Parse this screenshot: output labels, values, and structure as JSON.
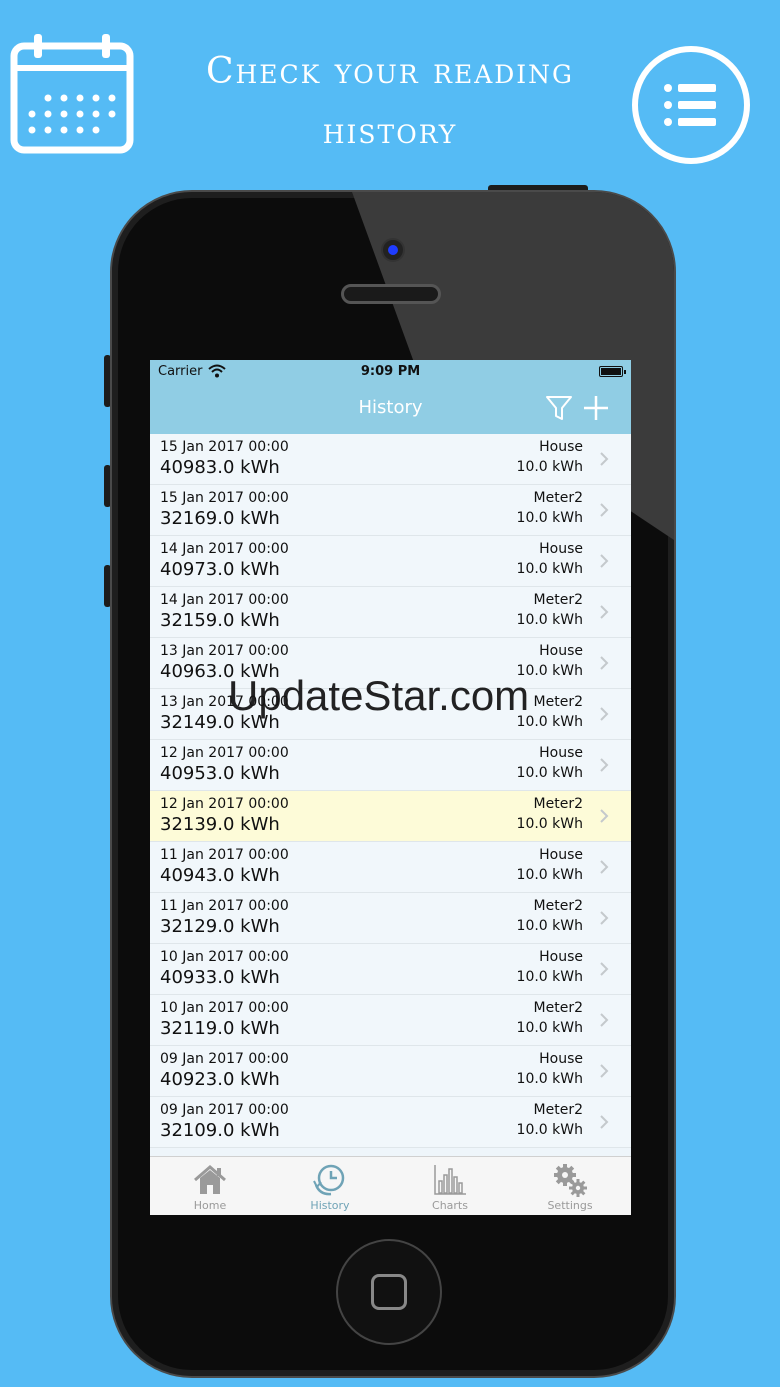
{
  "headline": {
    "line1": "Check your reading",
    "line2": "history"
  },
  "status": {
    "carrier": "Carrier",
    "time": "9:09 PM"
  },
  "nav": {
    "title": "History"
  },
  "rows": [
    {
      "date": "15 Jan 2017 00:00",
      "value": "40983.0 kWh",
      "meter": "House",
      "delta": "10.0 kWh"
    },
    {
      "date": "15 Jan 2017 00:00",
      "value": "32169.0 kWh",
      "meter": "Meter2",
      "delta": "10.0 kWh"
    },
    {
      "date": "14 Jan 2017 00:00",
      "value": "40973.0 kWh",
      "meter": "House",
      "delta": "10.0 kWh"
    },
    {
      "date": "14 Jan 2017 00:00",
      "value": "32159.0 kWh",
      "meter": "Meter2",
      "delta": "10.0 kWh"
    },
    {
      "date": "13 Jan 2017 00:00",
      "value": "40963.0 kWh",
      "meter": "House",
      "delta": "10.0 kWh"
    },
    {
      "date": "13 Jan 2017 00:00",
      "value": "32149.0 kWh",
      "meter": "Meter2",
      "delta": "10.0 kWh"
    },
    {
      "date": "12 Jan 2017 00:00",
      "value": "40953.0 kWh",
      "meter": "House",
      "delta": "10.0 kWh"
    },
    {
      "date": "12 Jan 2017 00:00",
      "value": "32139.0 kWh",
      "meter": "Meter2",
      "delta": "10.0 kWh",
      "highlight": true
    },
    {
      "date": "11 Jan 2017 00:00",
      "value": "40943.0 kWh",
      "meter": "House",
      "delta": "10.0 kWh"
    },
    {
      "date": "11 Jan 2017 00:00",
      "value": "32129.0 kWh",
      "meter": "Meter2",
      "delta": "10.0 kWh"
    },
    {
      "date": "10 Jan 2017 00:00",
      "value": "40933.0 kWh",
      "meter": "House",
      "delta": "10.0 kWh"
    },
    {
      "date": "10 Jan 2017 00:00",
      "value": "32119.0 kWh",
      "meter": "Meter2",
      "delta": "10.0 kWh"
    },
    {
      "date": "09 Jan 2017 00:00",
      "value": "40923.0 kWh",
      "meter": "House",
      "delta": "10.0 kWh"
    },
    {
      "date": "09 Jan 2017 00:00",
      "value": "32109.0 kWh",
      "meter": "Meter2",
      "delta": "10.0 kWh"
    }
  ],
  "tabs": {
    "home": "Home",
    "history": "History",
    "charts": "Charts",
    "settings": "Settings"
  },
  "watermark": "UpdateStar.com",
  "colors": {
    "background": "#55bbf5",
    "navbar": "#90cde4",
    "highlight_row": "#fdfbd8",
    "active_tab": "#6fa3b6"
  }
}
